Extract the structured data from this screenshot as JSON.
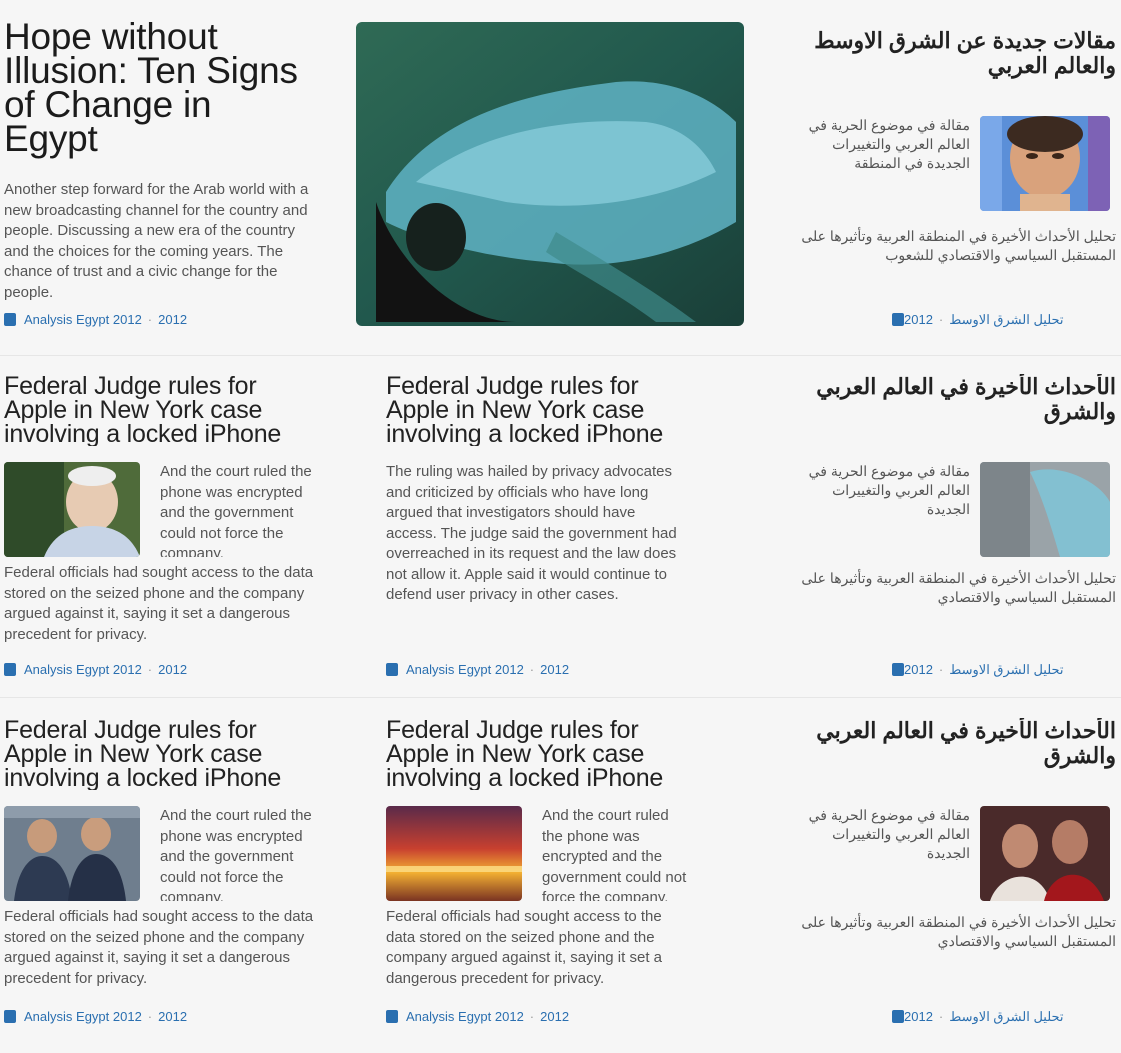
{
  "featured": {
    "title": "Hope without Illusion: Ten Signs of Change in Egypt",
    "excerpt": "Another step forward for the Arab world with a new broadcasting channel for the country and people. Discussing a new era of the country and the choices for the coming years. The chance of trust and a civic change for the people.",
    "meta": "Analysis Egypt 2012",
    "meta_date": "2012"
  },
  "right_top": {
    "title": "مقالات جديدة عن الشرق الاوسط والعالم العربي",
    "excerpt_side": "مقالة في موضوع الحرية في العالم العربي والتغييرات الجديدة في المنطقة",
    "excerpt_bottom": "تحليل الأحداث الأخيرة في المنطقة العربية وتأثيرها على المستقبل السياسي والاقتصادي للشعوب",
    "meta": "تحليل الشرق الاوسط",
    "meta_date": "2012"
  },
  "cards": [
    {
      "title": "Federal Judge rules for Apple in New York case involving a locked iPhone",
      "excerpt_side": "And the court ruled the phone was encrypted and the government could not force the company.",
      "excerpt_bottom": "Federal officials had sought access to the data stored on the seized phone and the company argued against it, saying it set a dangerous precedent for privacy.",
      "meta": "Analysis Egypt 2012",
      "meta_date": "2012"
    },
    {
      "title": "Federal Judge rules for Apple in New York case involving a locked iPhone",
      "excerpt_full": "The ruling was hailed by privacy advocates and criticized by officials who have long argued that investigators should have access. The judge said the government had overreached in its request and the law does not allow it. Apple said it would continue to defend user privacy in other cases.",
      "meta": "Analysis Egypt 2012",
      "meta_date": "2012"
    },
    {
      "title": "الأحداث الأخيرة في العالم العربي والشرق",
      "excerpt_side": "مقالة في موضوع الحرية في العالم العربي والتغييرات الجديدة",
      "excerpt_bottom": "تحليل الأحداث الأخيرة في المنطقة العربية وتأثيرها على المستقبل السياسي والاقتصادي",
      "meta": "تحليل الشرق الاوسط",
      "meta_date": "2012"
    },
    {
      "title": "Federal Judge rules for Apple in New York case involving a locked iPhone",
      "excerpt_side": "And the court ruled the phone was encrypted and the government could not force the company.",
      "excerpt_bottom": "Federal officials had sought access to the data stored on the seized phone and the company argued against it, saying it set a dangerous precedent for privacy.",
      "meta": "Analysis Egypt 2012",
      "meta_date": "2012"
    },
    {
      "title": "Federal Judge rules for Apple in New York case involving a locked iPhone",
      "excerpt_side": "And the court ruled the phone was encrypted and the government could not force the company.",
      "excerpt_bottom": "Federal officials had sought access to the data stored on the seized phone and the company argued against it, saying it set a dangerous precedent for privacy.",
      "meta": "Analysis Egypt 2012",
      "meta_date": "2012"
    },
    {
      "title": "الأحداث الأخيرة في العالم العربي والشرق",
      "excerpt_side": "مقالة في موضوع الحرية في العالم العربي والتغييرات الجديدة",
      "excerpt_bottom": "تحليل الأحداث الأخيرة في المنطقة العربية وتأثيرها على المستقبل السياسي والاقتصادي",
      "meta": "تحليل الشرق الاوسط",
      "meta_date": "2012"
    }
  ],
  "colors": {
    "link": "#2a6fb0",
    "background": "#f6f6f6",
    "text": "#1d1d1d"
  }
}
